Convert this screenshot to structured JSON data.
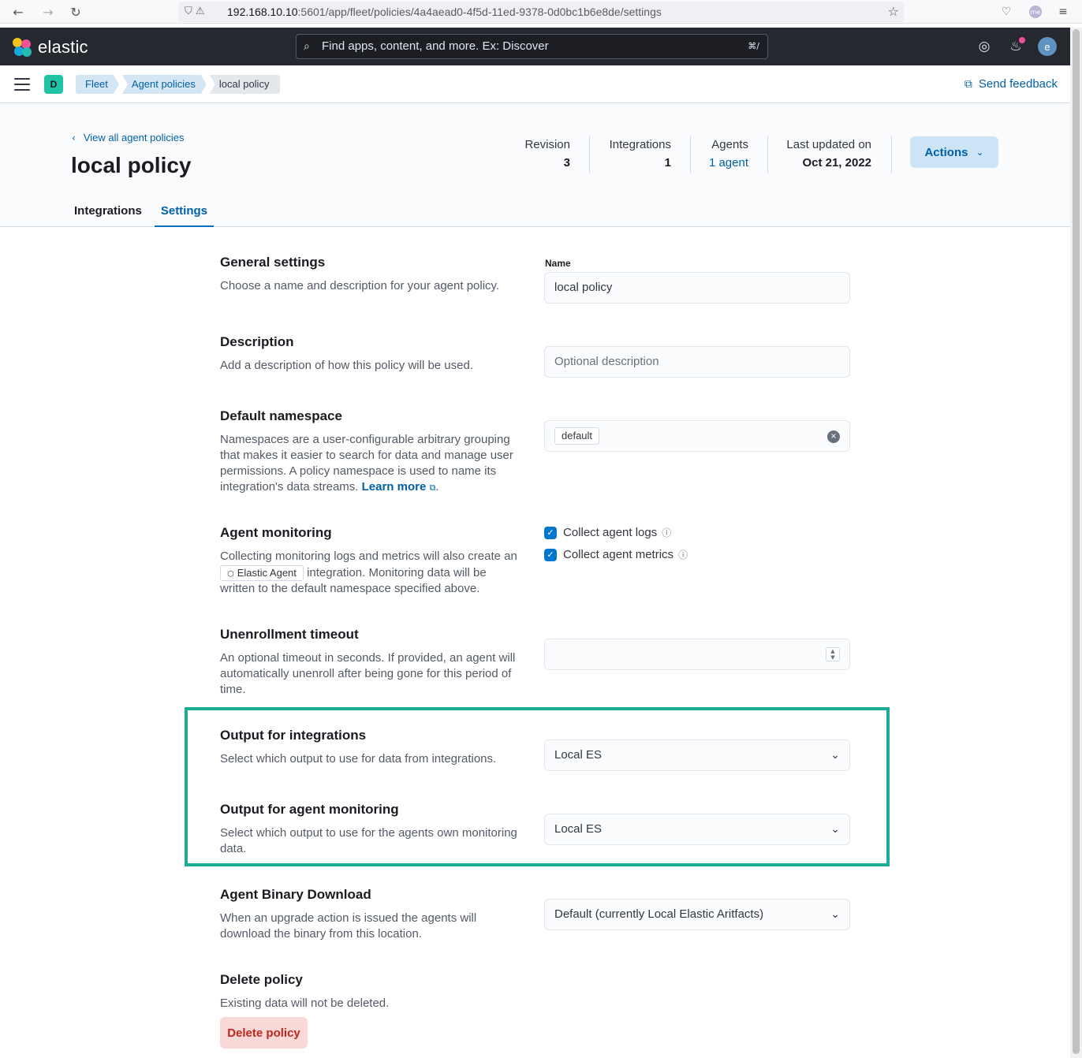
{
  "browser": {
    "url_host": "192.168.10.10",
    "url_rest": ":5601/app/fleet/policies/4a4aead0-4f5d-11ed-9378-0d0bc1b6e8de/settings",
    "profile_initials": "me"
  },
  "header": {
    "brand": "elastic",
    "search_placeholder": "Find apps, content, and more. Ex: Discover",
    "search_shortcut": "⌘/",
    "user_initial": "e",
    "space_initial": "D",
    "breadcrumbs": [
      "Fleet",
      "Agent policies",
      "local policy"
    ],
    "feedback_label": "Send feedback"
  },
  "page": {
    "back_link": "View all agent policies",
    "title": "local policy",
    "stats": {
      "revision_label": "Revision",
      "revision_value": "3",
      "integrations_label": "Integrations",
      "integrations_value": "1",
      "agents_label": "Agents",
      "agents_value": "1 agent",
      "updated_label": "Last updated on",
      "updated_value": "Oct 21, 2022"
    },
    "actions_label": "Actions",
    "tabs": [
      "Integrations",
      "Settings"
    ]
  },
  "form": {
    "general": {
      "title": "General settings",
      "desc": "Choose a name and description for your agent policy.",
      "name_label": "Name",
      "name_value": "local policy"
    },
    "description": {
      "title": "Description",
      "desc": "Add a description of how this policy will be used.",
      "placeholder": "Optional description"
    },
    "namespace": {
      "title": "Default namespace",
      "desc": "Namespaces are a user-configurable arbitrary grouping that makes it easier to search for data and manage user permissions. A policy namespace is used to name its integration's data streams.",
      "learn_more": "Learn more",
      "value": "default"
    },
    "monitoring": {
      "title": "Agent monitoring",
      "desc_pre": "Collecting monitoring logs and metrics will also create an",
      "badge": "Elastic Agent",
      "desc_post": "integration. Monitoring data will be written to the default namespace specified above.",
      "logs_label": "Collect agent logs",
      "metrics_label": "Collect agent metrics"
    },
    "unenroll": {
      "title": "Unenrollment timeout",
      "desc": "An optional timeout in seconds. If provided, an agent will automatically unenroll after being gone for this period of time."
    },
    "output_integrations": {
      "title": "Output for integrations",
      "desc": "Select which output to use for data from integrations.",
      "value": "Local ES"
    },
    "output_monitoring": {
      "title": "Output for agent monitoring",
      "desc": "Select which output to use for the agents own monitoring data.",
      "value": "Local ES"
    },
    "binary": {
      "title": "Agent Binary Download",
      "desc": "When an upgrade action is issued the agents will download the binary from this location.",
      "value": "Default (currently Local Elastic Aritfacts)"
    },
    "delete": {
      "title": "Delete policy",
      "desc": "Existing data will not be deleted.",
      "button": "Delete policy"
    }
  },
  "colors": {
    "highlight": "#1bab96",
    "link": "#0061a6",
    "danger": "#bd271e"
  }
}
